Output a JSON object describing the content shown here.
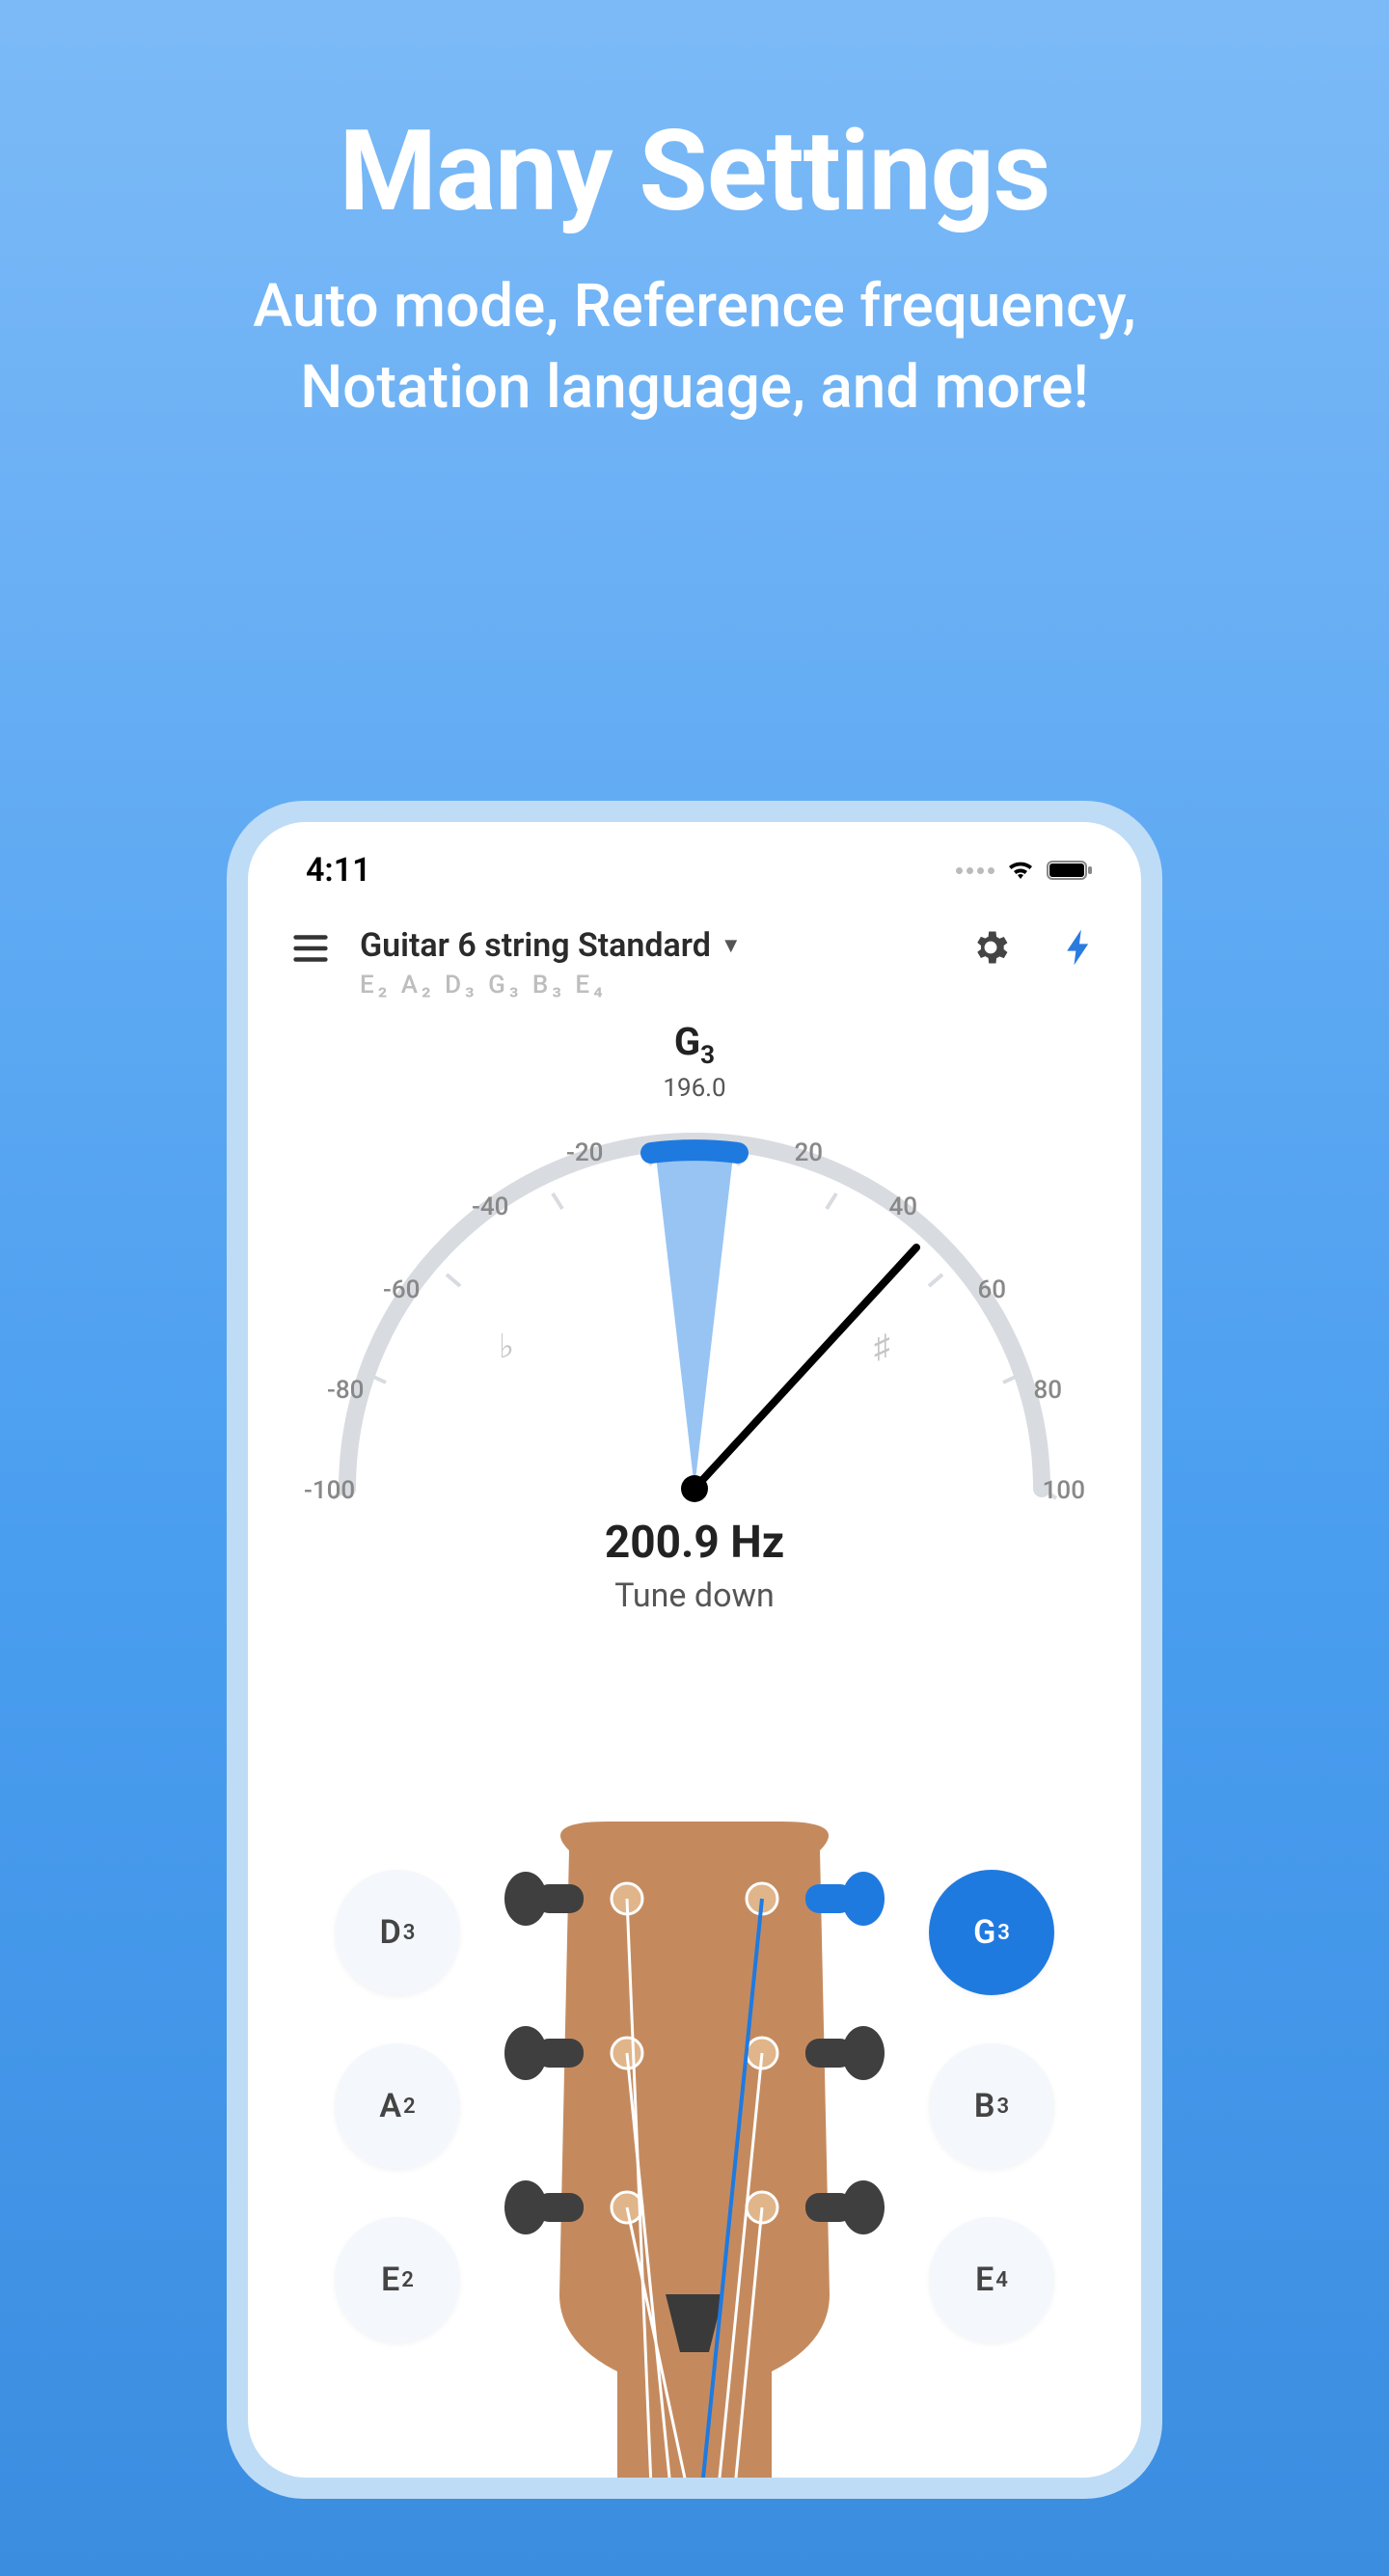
{
  "promo": {
    "title": "Many Settings",
    "subtitle_line1": "Auto mode, Reference frequency,",
    "subtitle_line2": "Notation language, and more!"
  },
  "statusbar": {
    "time": "4:11"
  },
  "appbar": {
    "tuning_name": "Guitar 6 string Standard",
    "tuning_notes_html": "E₂ A₂ D₃ G₃ B₃ E₄"
  },
  "gauge": {
    "target_note": "G",
    "target_note_oct": "3",
    "target_freq": "196.0",
    "scale": {
      "m100": "-100",
      "m80": "-80",
      "m60": "-60",
      "m40": "-40",
      "m20": "-20",
      "p20": "20",
      "p40": "40",
      "p60": "60",
      "p80": "80",
      "p100": "100"
    },
    "flat_symbol": "♭",
    "sharp_symbol": "♯"
  },
  "readout": {
    "freq": "200.9 Hz",
    "hint": "Tune down"
  },
  "strings": {
    "d3": {
      "n": "D",
      "o": "3"
    },
    "a2": {
      "n": "A",
      "o": "2"
    },
    "e2": {
      "n": "E",
      "o": "2"
    },
    "g3": {
      "n": "G",
      "o": "3"
    },
    "b3": {
      "n": "B",
      "o": "3"
    },
    "e4": {
      "n": "E",
      "o": "4"
    }
  },
  "colors": {
    "accent": "#1f7ae0",
    "headstock": "#c48a5e",
    "peg": "#3f3f3f"
  }
}
